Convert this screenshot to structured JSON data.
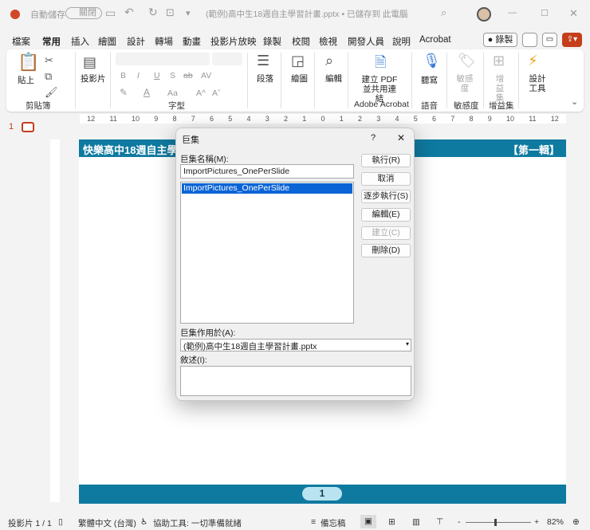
{
  "titlebar": {
    "autosave_label": "自動儲存",
    "autosave_state": "關閉",
    "doc_title": "(範例)高中生18週自主學習計畫.pptx • 已儲存到 此電腦"
  },
  "tabs": [
    "檔案",
    "常用",
    "插入",
    "繪圖",
    "設計",
    "轉場",
    "動畫",
    "投影片放映",
    "錄製",
    "校閱",
    "檢視",
    "開發人員",
    "說明",
    "Acrobat"
  ],
  "active_tab": "常用",
  "record_button": "錄製",
  "ribbon": {
    "paste": "貼上",
    "clipboard": "剪貼簿",
    "slides": "投影片",
    "font_group": "字型",
    "paragraph": "段落",
    "drawing": "繪圖",
    "editing": "編輯",
    "create_pdf": "建立 PDF 並共用連結",
    "adobe_acrobat": "Adobe Acrobat",
    "dictate": "聽寫",
    "voice": "語音",
    "sensitivity": "敏感度",
    "sensitivity_group": "敏感度",
    "addins": "增益集",
    "addins_group": "增益集",
    "designer": "設計工具",
    "font_buttons": [
      "B",
      "I",
      "U",
      "S",
      "ab",
      "AV",
      "Aa",
      "A^",
      "Aˇ"
    ]
  },
  "ruler_ticks": [
    "12",
    "11",
    "10",
    "9",
    "8",
    "7",
    "6",
    "5",
    "4",
    "3",
    "2",
    "1",
    "0",
    "1",
    "2",
    "3",
    "4",
    "5",
    "6",
    "7",
    "8",
    "9",
    "10",
    "11",
    "12"
  ],
  "thumbnail_number": "1",
  "slide": {
    "header_title": "快樂高中18週自主學",
    "header_right": "【第一輯】",
    "page_number": "1"
  },
  "dialog": {
    "title": "巨集",
    "help": "?",
    "close": "✕",
    "name_label": "巨集名稱(M):",
    "name_value": "ImportPictures_OnePerSlide",
    "macros": [
      "ImportPictures_OnePerSlide"
    ],
    "buttons": {
      "run": "執行(R)",
      "cancel": "取消",
      "step": "逐步執行(S)",
      "edit": "編輯(E)",
      "create": "建立(C)",
      "delete": "刪除(D)"
    },
    "macro_in_label": "巨集作用於(A):",
    "macro_in_value": "(範例)高中生18週自主學習計畫.pptx",
    "description_label": "敘述(I):",
    "description_value": ""
  },
  "status": {
    "slide": "投影片 1 / 1",
    "language": "繁體中文 (台灣)",
    "accessibility": "協助工具: 一切準備就緒",
    "notes": "備忘稿",
    "zoom": "82%"
  },
  "colors": {
    "accent": "#c43e1c",
    "slide_teal": "#0f7aa0",
    "selection": "#0a64d6"
  }
}
